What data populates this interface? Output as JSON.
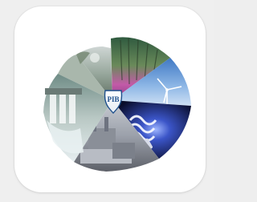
{
  "app_icon": {
    "name": "pib-app-icon",
    "logo_text": "PIB",
    "colors": {
      "background": "#efefef",
      "tile": "#ffffff",
      "shield_blue": "#1d4f8c",
      "shield_border": "#dfe6ee"
    },
    "segments": [
      "forest-sunset",
      "wind-turbine-sky",
      "cfl-bulb-dark",
      "industrial-plant",
      "dam-spillway",
      "misty-landscape"
    ]
  }
}
